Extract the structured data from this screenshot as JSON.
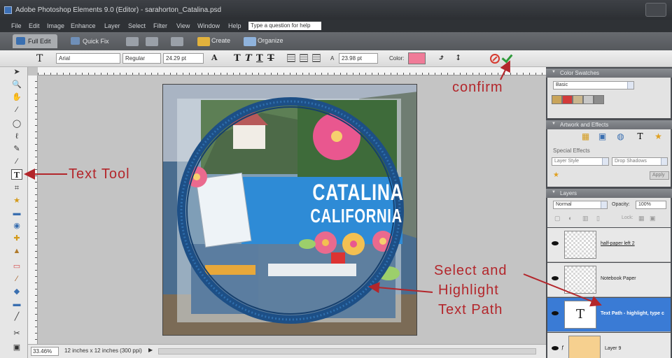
{
  "window": {
    "title": "Adobe Photoshop Elements 9.0 (Editor) - sarahorton_Catalina.psd"
  },
  "menu": {
    "items": [
      "File",
      "Edit",
      "Image",
      "Enhance",
      "Layer",
      "Select",
      "Filter",
      "View",
      "Window",
      "Help"
    ],
    "help_placeholder": "Type a question for help"
  },
  "modes": {
    "full_edit": "Full Edit",
    "quick_fix": "Quick Fix",
    "create": "Create",
    "organize": "Organize"
  },
  "options": {
    "font_family": "Arial",
    "font_style": "Regular",
    "font_size": "24.29 pt",
    "leading": "23.98 pt",
    "color_label": "Color:",
    "text_color": "#f07b98"
  },
  "canvas": {
    "title_line1": "CATALINA",
    "title_line2": "CALIFORNIA"
  },
  "statusbar": {
    "zoom": "33.46%",
    "doc_size": "12 inches x 12 inches (300 ppi)"
  },
  "panels": {
    "color_swatches": {
      "title": "Color Swatches",
      "set_name": "Basic",
      "swatches": [
        "#c9a45a",
        "#d23a3a",
        "#c9b68e",
        "#c7c7c7",
        "#8c8c8c"
      ]
    },
    "artwork": {
      "title": "Artwork and Effects",
      "special_effects_label": "Special Effects",
      "effect_category": "Layer Style",
      "effect_type": "Drop Shadows",
      "apply_label": "Apply"
    },
    "layers": {
      "title": "Layers",
      "blend_mode": "Normal",
      "opacity_label": "Opacity:",
      "opacity_value": "100%",
      "lock_label": "Lock:",
      "rows": [
        {
          "name": "half-paper left 2"
        },
        {
          "name": "Notebook Paper"
        },
        {
          "name": "Text Path - highlight, type c"
        },
        {
          "name": "Layer 9"
        }
      ]
    }
  },
  "annotations": {
    "confirm": "confirm",
    "text_tool": "Text Tool",
    "select_line1": "Select and",
    "select_line2": "Highlight",
    "select_line3": "Text Path"
  },
  "colors": {
    "annotation_red": "#b3262b",
    "selected_layer_blue": "#3a7bd5",
    "title_blue": "#2e8bd6"
  }
}
